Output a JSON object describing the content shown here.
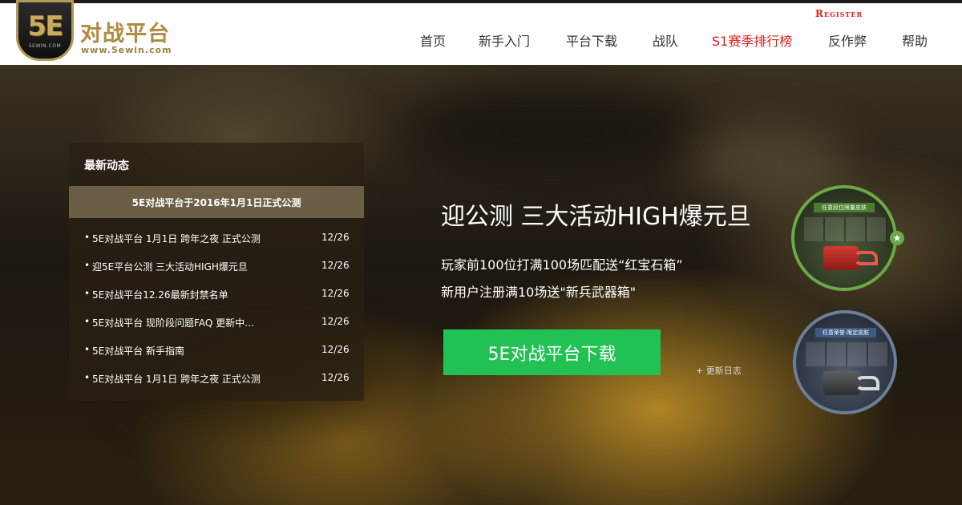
{
  "brand": {
    "badge_mark": "5E",
    "badge_sub": "5EWIN.COM",
    "title": "对战平台",
    "url": "www.5ewin.com"
  },
  "header": {
    "register_label": "Register",
    "nav": [
      {
        "label": "首页"
      },
      {
        "label": "新手入门"
      },
      {
        "label": "平台下载"
      },
      {
        "label": "战队"
      },
      {
        "label": "S1赛季排行榜"
      },
      {
        "label": "反作弊"
      },
      {
        "label": "帮助"
      }
    ]
  },
  "news": {
    "title": "最新动态",
    "feature": "5E对战平台于2016年1月1日正式公测",
    "items": [
      {
        "text": "5E对战平台 1月1日 跨年之夜 正式公测",
        "date": "12/26"
      },
      {
        "text": "迎5E平台公测 三大活动HIGH爆元旦",
        "date": "12/26"
      },
      {
        "text": "5E对战平台12.26最新封禁名单",
        "date": "12/26"
      },
      {
        "text": "5E对战平台 现阶段问题FAQ 更新中…",
        "date": "12/26"
      },
      {
        "text": "5E对战平台 新手指南",
        "date": "12/26"
      },
      {
        "text": "5E对战平台 1月1日 跨年之夜 正式公测",
        "date": "12/26"
      }
    ]
  },
  "promo": {
    "heading": "迎公测 三大活动HIGH爆元旦",
    "line1": "玩家前100位打满100场匹配送“红宝石箱”",
    "line2": "新用户注册满10场送\"新兵武器箱\"",
    "download_label": "5E对战平台下载",
    "changelog_label": "+ 更新日志"
  },
  "badges": {
    "green_label": "任意段位限量皮肤",
    "blue_label": "任意荣誉·限定皮肤"
  },
  "colors": {
    "accent_gold": "#b08a3e",
    "hot_red": "#d8201c",
    "download_green": "#21c153"
  }
}
